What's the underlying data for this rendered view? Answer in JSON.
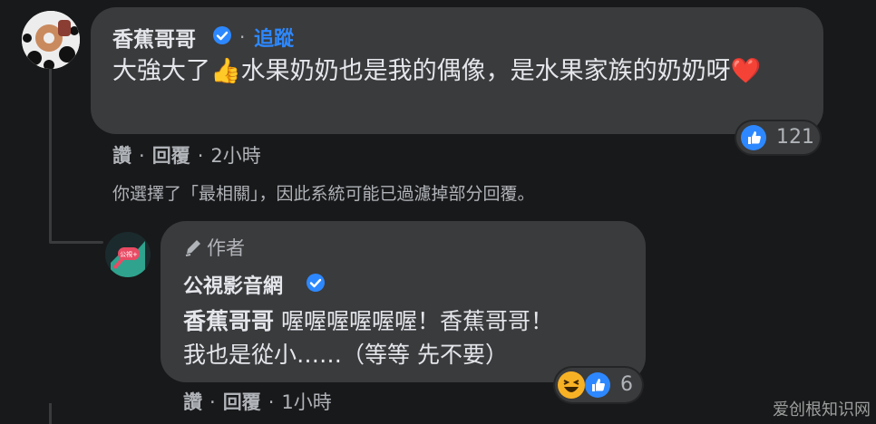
{
  "comment": {
    "author": "香蕉哥哥",
    "follow_label": "追蹤",
    "separator": "·",
    "text": "大強大了👍水果奶奶也是我的偶像，是水果家族的奶奶呀❤️",
    "reaction_count": "121",
    "actions": {
      "like": "讚",
      "reply": "回覆",
      "time": "2小時"
    }
  },
  "filter_notice": "你選擇了「最相關」，因此系統可能已過濾掉部分回覆。",
  "reply": {
    "author_badge": "作者",
    "author": "公視影音網",
    "mention": "香蕉哥哥",
    "text_after_mention": " 喔喔喔喔喔喔！香蕉哥哥！",
    "text_line2": "我也是從小……（等等 先不要）",
    "reaction_count": "6",
    "actions": {
      "like": "讚",
      "reply": "回覆",
      "time": "1小時"
    }
  },
  "watermark": "爱创根知识网",
  "colors": {
    "background": "#18191a",
    "bubble": "#3a3b3c",
    "link": "#2d88ff",
    "muted": "#b0b3b8"
  },
  "icons": [
    "verified-badge-icon",
    "like-reaction-icon",
    "haha-reaction-icon",
    "pen-icon"
  ]
}
